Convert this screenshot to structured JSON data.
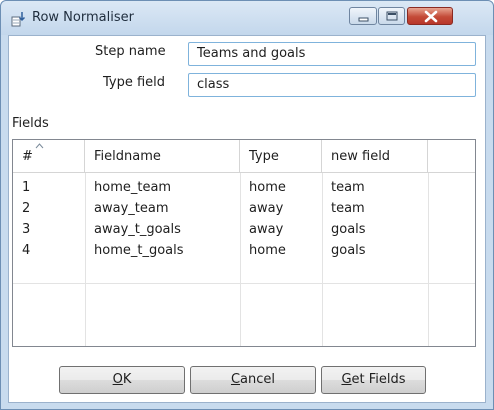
{
  "window": {
    "title": "Row Normaliser"
  },
  "form": {
    "step_name_label": "Step name",
    "step_name_value": "Teams and goals",
    "type_field_label": "Type field",
    "type_field_value": "class"
  },
  "fields_section": {
    "label": "Fields"
  },
  "table": {
    "columns": [
      "#",
      "Fieldname",
      "Type",
      "new field"
    ],
    "rows": [
      [
        "1",
        "home_team",
        "home",
        "team"
      ],
      [
        "2",
        "away_team",
        "away",
        "team"
      ],
      [
        "3",
        "away_t_goals",
        "away",
        "goals"
      ],
      [
        "4",
        "home_t_goals",
        "home",
        "goals"
      ]
    ]
  },
  "buttons": {
    "ok": {
      "mnemonic": "O",
      "rest": "K"
    },
    "cancel": {
      "mnemonic": "C",
      "rest": "ancel"
    },
    "get_fields": {
      "mnemonic": "G",
      "rest": "et Fields"
    }
  }
}
